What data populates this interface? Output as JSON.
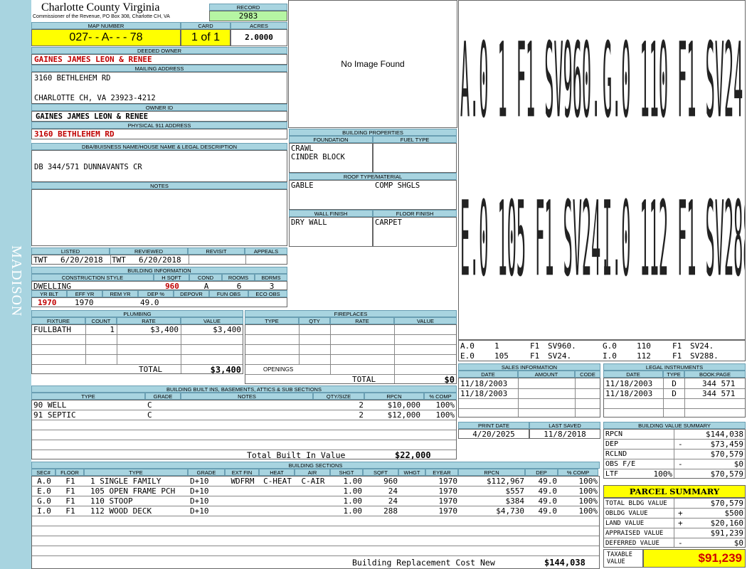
{
  "county_title": "Charlotte County Virginia",
  "county_sub": "Commissioner of the Revenue, PO Box 308, Charlotte CH, VA",
  "record": {
    "label": "RECORD",
    "value": "2983"
  },
  "map": {
    "label": "MAP NUMBER",
    "value": "027- - A- - - 78"
  },
  "card": {
    "label": "CARD",
    "value": "1 of 1"
  },
  "acres": {
    "label": "ACRES",
    "value": "2.0000"
  },
  "deeded_owner": {
    "label": "DEEDED OWNER",
    "value": "GAINES JAMES LEON & RENEE"
  },
  "mailing": {
    "label": "MAILING ADDRESS",
    "line1": "3160 BETHLEHEM RD",
    "line2": "CHARLOTTE CH, VA 23923-4212"
  },
  "owner_id": {
    "label": "OWNER ID",
    "value": "GAINES JAMES LEON & RENEE"
  },
  "physical": {
    "label": "PHYSICAL 911 ADDRESS",
    "value": "3160 BETHLEHEM RD"
  },
  "dba": {
    "label": "DBA/BUISNESS NAME/HOUSE NAME & LEGAL DESCRIPTION",
    "value": "DB 344/571 DUNNAVANTS CR"
  },
  "notes": {
    "label": "NOTES"
  },
  "image": {
    "text": "No Image Found"
  },
  "district": "MADISON",
  "listed": {
    "h_listed": "LISTED",
    "h_reviewed": "REVIEWED",
    "h_revisit": "REVISIT",
    "h_appeals": "APPEALS",
    "listed_by": "TWT",
    "listed_date": "6/20/2018",
    "rev_by": "TWT",
    "rev_date": "6/20/2018"
  },
  "bldg_info": {
    "label": "BUILDING INFORMATION",
    "h_style": "CONSTRUCTION STYLE",
    "h_hsqft": "H SQFT",
    "h_cond": "COND",
    "h_rooms": "ROOMS",
    "h_bdrms": "BDRMS",
    "style": "DWELLING",
    "hsqft": "960",
    "cond": "A",
    "rooms": "6",
    "bdrms": "3",
    "h_yrblt": "YR BLT",
    "h_effyr": "EFF YR",
    "h_remyr": "REM YR",
    "h_dep": "DEP %",
    "h_depovr": "DEPOVR",
    "h_funobs": "FUN OBS",
    "h_ecoobs": "ECO OBS",
    "yrblt": "1970",
    "effyr": "1970",
    "dep": "49.0"
  },
  "bldg_props": {
    "label": "BUILDING PROPERTIES",
    "h_found": "FOUNDATION",
    "h_fuel": "FUEL TYPE",
    "found1": "CRAWL",
    "found2": "CINDER BLOCK",
    "h_roof": "ROOF TYPE/MATERIAL",
    "roof1": "GABLE",
    "roof2": "COMP SHGLS",
    "h_wall": "WALL FINISH",
    "h_floor": "FLOOR FINISH",
    "wall": "DRY WALL",
    "floor": "CARPET"
  },
  "sketch_labels": [
    {
      "a": "A.0 1 F1 SV960.",
      "b": "G.0 110 F1 SV24."
    },
    {
      "a": "E.0 105 F1 SV24.",
      "b": "I.0 112 F1 SV288."
    }
  ],
  "sketch_legend": [
    [
      "A.0",
      "1",
      "F1",
      "SV960.",
      "G.0",
      "110",
      "F1",
      "SV24."
    ],
    [
      "E.0",
      "105",
      "F1",
      "SV24.",
      "I.0",
      "112",
      "F1",
      "SV288."
    ]
  ],
  "plumbing": {
    "label": "PLUMBING",
    "h_fixture": "FIXTURE",
    "h_count": "COUNT",
    "h_rate": "RATE",
    "h_value": "VALUE",
    "fixture": "FULLBATH",
    "count": "1",
    "rate": "$3,400",
    "value": "$3,400",
    "total_label": "TOTAL",
    "total": "$3,400"
  },
  "fireplaces": {
    "label": "FIREPLACES",
    "h_type": "TYPE",
    "h_qty": "QTY",
    "h_rate": "RATE",
    "h_value": "VALUE",
    "openings": "OPENINGS",
    "total_label": "TOTAL",
    "total": "$0"
  },
  "sales": {
    "label": "SALES INFORMATION",
    "h_date": "DATE",
    "h_amount": "AMOUNT",
    "h_code": "CODE",
    "rows": [
      {
        "date": "11/18/2003"
      },
      {
        "date": "11/18/2003"
      }
    ]
  },
  "legal": {
    "label": "LEGAL INSTRUMENTS",
    "h_date": "DATE",
    "h_type": "TYPE",
    "h_book": "BOOK:PAGE",
    "rows": [
      {
        "date": "11/18/2003",
        "type": "D",
        "book": "344 571"
      },
      {
        "date": "11/18/2003",
        "type": "D",
        "book": "344 571"
      }
    ]
  },
  "builtins": {
    "label": "BUILDING BUILT INS, BASEMENTS, ATTICS & SUB SECTIONS",
    "h_type": "TYPE",
    "h_grade": "GRADE",
    "h_notes": "NOTES",
    "h_qty": "QTY/SIZE",
    "h_rpcn": "RPCN",
    "h_comp": "% COMP",
    "rows": [
      {
        "type": "90 WELL",
        "grade": "C",
        "qty": "2",
        "rpcn": "$10,000",
        "comp": "100%"
      },
      {
        "type": "91 SEPTIC",
        "grade": "C",
        "qty": "2",
        "rpcn": "$12,000",
        "comp": "100%"
      }
    ],
    "total_label": "Total Built In Value",
    "total": "$22,000"
  },
  "print": {
    "h_print": "PRINT DATE",
    "h_saved": "LAST SAVED",
    "print_date": "4/20/2025",
    "saved": "11/8/2018"
  },
  "bvs": {
    "label": "BUILDING VALUE SUMMARY",
    "rows": [
      {
        "k": "RPCN",
        "s": "",
        "v": "$144,038"
      },
      {
        "k": "DEP",
        "s": "-",
        "v": "$73,459"
      },
      {
        "k": "RCLND",
        "s": "",
        "v": "$70,579"
      },
      {
        "k": "OBS F/E",
        "s": "-",
        "v": "$0"
      },
      {
        "k": "LTF",
        "p": "100%",
        "s": "",
        "v": "$70,579"
      }
    ]
  },
  "parcel": {
    "label": "PARCEL SUMMARY",
    "rows": [
      {
        "k": "TOTAL BLDG VALUE",
        "s": "",
        "v": "$70,579"
      },
      {
        "k": "OBLDG VALUE",
        "s": "+",
        "v": "$500"
      },
      {
        "k": "LAND VALUE",
        "s": "+",
        "v": "$20,160"
      },
      {
        "k": "APPRAISED VALUE",
        "s": "",
        "v": "$91,239"
      },
      {
        "k": "DEFERRED VALUE",
        "s": "-",
        "v": "$0"
      }
    ],
    "taxable_label1": "TAXABLE",
    "taxable_label2": "VALUE",
    "taxable": "$91,239"
  },
  "sections": {
    "label": "BUILDING SECTIONS",
    "h": [
      "SEC#",
      "FLOOR",
      "TYPE",
      "GRADE",
      "EXT FIN",
      "HEAT",
      "AIR",
      "SHGT",
      "SQFT",
      "WHGT",
      "EYEAR",
      "RPCN",
      "DEP",
      "% COMP"
    ],
    "rows": [
      [
        "A.0",
        "F1",
        "1 SINGLE FAMILY",
        "D+10",
        "WDFRM",
        "C-HEAT",
        "C-AIR",
        "1.00",
        "960",
        "",
        "1970",
        "$112,967",
        "49.0",
        "100%"
      ],
      [
        "E.0",
        "F1",
        "105 OPEN FRAME PCH",
        "D+10",
        "",
        "",
        "",
        "1.00",
        "24",
        "",
        "1970",
        "$557",
        "49.0",
        "100%"
      ],
      [
        "G.0",
        "F1",
        "110 STOOP",
        "D+10",
        "",
        "",
        "",
        "1.00",
        "24",
        "",
        "1970",
        "$384",
        "49.0",
        "100%"
      ],
      [
        "I.0",
        "F1",
        "112 WOOD DECK",
        "D+10",
        "",
        "",
        "",
        "1.00",
        "288",
        "",
        "1970",
        "$4,730",
        "49.0",
        "100%"
      ]
    ],
    "total_label": "Building Replacement Cost New",
    "total": "$144,038"
  }
}
